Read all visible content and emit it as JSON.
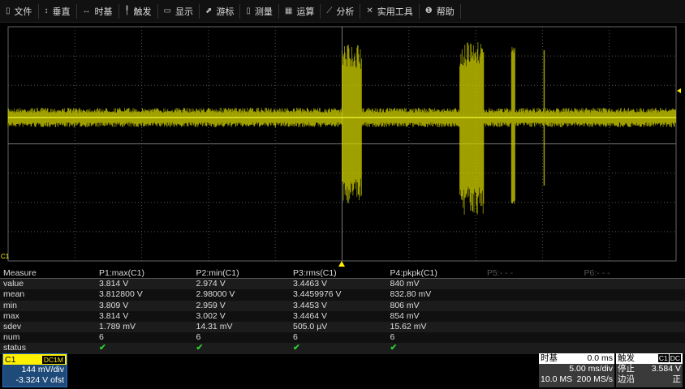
{
  "menu": [
    {
      "icon": "clipboard-icon",
      "glyph": "▯",
      "label": "文件"
    },
    {
      "icon": "vertical-arrows-icon",
      "glyph": "↕",
      "label": "垂直"
    },
    {
      "icon": "horizontal-arrows-icon",
      "glyph": "↔",
      "label": "时基"
    },
    {
      "icon": "trigger-flag-icon",
      "glyph": "╿",
      "label": "触发"
    },
    {
      "icon": "display-icon",
      "glyph": "▭",
      "label": "显示"
    },
    {
      "icon": "cursor-icon",
      "glyph": "⬈",
      "label": "游标"
    },
    {
      "icon": "measure-icon",
      "glyph": "▯",
      "label": "测量"
    },
    {
      "icon": "calculator-icon",
      "glyph": "▦",
      "label": "运算"
    },
    {
      "icon": "analysis-chart-icon",
      "glyph": "⟋",
      "label": "分析"
    },
    {
      "icon": "tools-icon",
      "glyph": "✕",
      "label": "实用工具"
    },
    {
      "icon": "info-icon",
      "glyph": "❶",
      "label": "帮助"
    }
  ],
  "scope": {
    "channel_marker": "C1",
    "trace_color": "#d4d400"
  },
  "measure": {
    "headers": [
      "Measure",
      "P1:max(C1)",
      "P2:min(C1)",
      "P3:rms(C1)",
      "P4:pkpk(C1)",
      "P5:- - -",
      "P6:- - -"
    ],
    "rows": [
      [
        "value",
        "3.814 V",
        "2.974 V",
        "3.4463 V",
        "840 mV"
      ],
      [
        "mean",
        "3.812800 V",
        "2.98000 V",
        "3.4459976 V",
        "832.80 mV"
      ],
      [
        "min",
        "3.809 V",
        "2.959 V",
        "3.4453 V",
        "806 mV"
      ],
      [
        "max",
        "3.814 V",
        "3.002 V",
        "3.4464 V",
        "854 mV"
      ],
      [
        "sdev",
        "1.789 mV",
        "14.31 mV",
        "505.0 µV",
        "15.62 mV"
      ],
      [
        "num",
        "6",
        "6",
        "6",
        "6"
      ],
      [
        "status",
        "✔",
        "✔",
        "✔",
        "✔"
      ]
    ]
  },
  "channel": {
    "name": "C1",
    "coupling": "DC1M",
    "scale": "144 mV/div",
    "offset": "-3.324 V ofst"
  },
  "timebase": {
    "title": "时基",
    "delay": "0.0 ms",
    "scale": "5.00 ms/div",
    "memory": "10.0 MS",
    "rate": "200 MS/s"
  },
  "trigger": {
    "title": "触发",
    "source": "C1",
    "coupling": "DC",
    "state_label": "停止",
    "level": "3.584 V",
    "edge_label": "边沿",
    "slope": "正"
  }
}
